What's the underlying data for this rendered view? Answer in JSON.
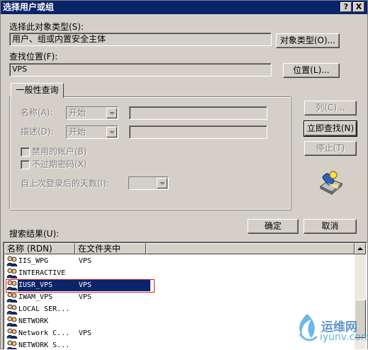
{
  "window": {
    "title": "选择用户或组",
    "help_glyph": "?",
    "close_glyph": "X"
  },
  "object_type": {
    "label": "选择此对象类型(S):",
    "value": "用户、组或内置安全主体",
    "button": "对象类型(O)..."
  },
  "location": {
    "label": "查找位置(F):",
    "value": "VPS",
    "button": "位置(L)..."
  },
  "query_tab": {
    "label": "一般性查询"
  },
  "query": {
    "name_label": "名称(A):",
    "name_combo": "开始",
    "desc_label": "描述(D):",
    "desc_combo": "开始",
    "disabled_accounts": "禁用的帐户(B)",
    "no_expire": "不过期密码(X)",
    "days_label": "自上次登录后的天数(I):"
  },
  "side_buttons": {
    "columns": "列(C)...",
    "find_now": "立即查找(N)",
    "stop": "停止(T)"
  },
  "bottom_buttons": {
    "ok": "确定",
    "cancel": "取消"
  },
  "results": {
    "label": "搜索结果(U):",
    "columns": [
      "名称 (RDN)",
      "在文件夹中"
    ],
    "rows": [
      {
        "name": "IIS_WPG",
        "folder": "VPS"
      },
      {
        "name": "INTERACTIVE",
        "folder": ""
      },
      {
        "name": "IUSR_VPS",
        "folder": "VPS"
      },
      {
        "name": "IWAM_VPS",
        "folder": "VPS"
      },
      {
        "name": "LOCAL SER...",
        "folder": ""
      },
      {
        "name": "NETWORK",
        "folder": ""
      },
      {
        "name": "Network C...",
        "folder": "VPS"
      },
      {
        "name": "NETWORK S...",
        "folder": ""
      }
    ],
    "selected_index": 2
  },
  "watermark": {
    "text": "运维网",
    "url": "iyunv.com"
  },
  "colors": {
    "face": "#d4d0c8",
    "title_bar": "#0a246a",
    "selection": "#0a246a",
    "highlight_box": "#e02020"
  }
}
